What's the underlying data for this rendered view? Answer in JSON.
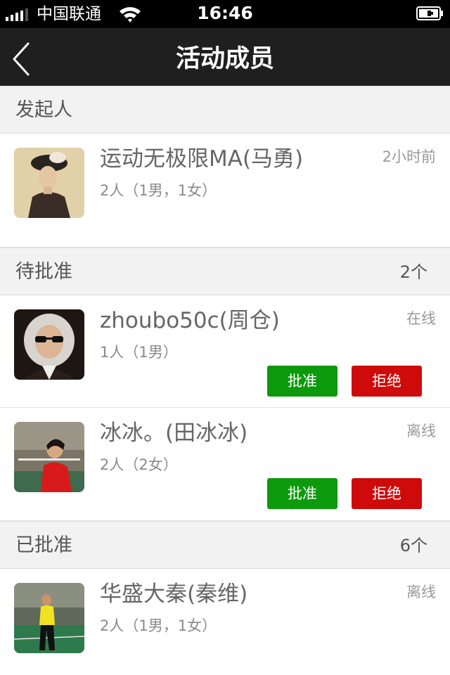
{
  "status_bar": {
    "carrier": "中国联通",
    "time": "16:46"
  },
  "nav": {
    "title": "活动成员"
  },
  "sections": [
    {
      "title": "发起人",
      "count": ""
    },
    {
      "title": "待批准",
      "count": "2个"
    },
    {
      "title": "已批准",
      "count": "6个"
    }
  ],
  "organizer": {
    "name": "运动无极限MA(马勇)",
    "detail": "2人（1男，1女）",
    "status": "2小时前"
  },
  "pending": [
    {
      "name": "zhoubo50c(周仓)",
      "detail": "1人（1男）",
      "status": "在线",
      "approve_label": "批准",
      "reject_label": "拒绝"
    },
    {
      "name": "冰冰。(田冰冰)",
      "detail": "2人（2女）",
      "status": "离线",
      "approve_label": "批准",
      "reject_label": "拒绝"
    }
  ],
  "approved": [
    {
      "name": "华盛大秦(秦维)",
      "detail": "2人（1男，1女）",
      "status": "离线"
    }
  ],
  "colors": {
    "approve": "#0c9a0c",
    "reject": "#cf0a0a",
    "navbar": "#1f1f1f"
  }
}
